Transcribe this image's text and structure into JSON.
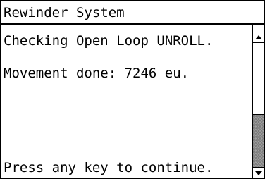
{
  "window": {
    "title": "Rewinder System"
  },
  "content": {
    "lines": [
      "Checking Open Loop UNROLL.",
      "Movement done: 7246 eu.",
      "Press any key to continue."
    ]
  },
  "scrollbar": {
    "up_icon": "arrow-up-icon",
    "down_icon": "arrow-down-icon",
    "thumb_start_fraction": 0.57,
    "thumb_end_fraction": 1.0,
    "thumb_color": "#a0a0a0"
  }
}
